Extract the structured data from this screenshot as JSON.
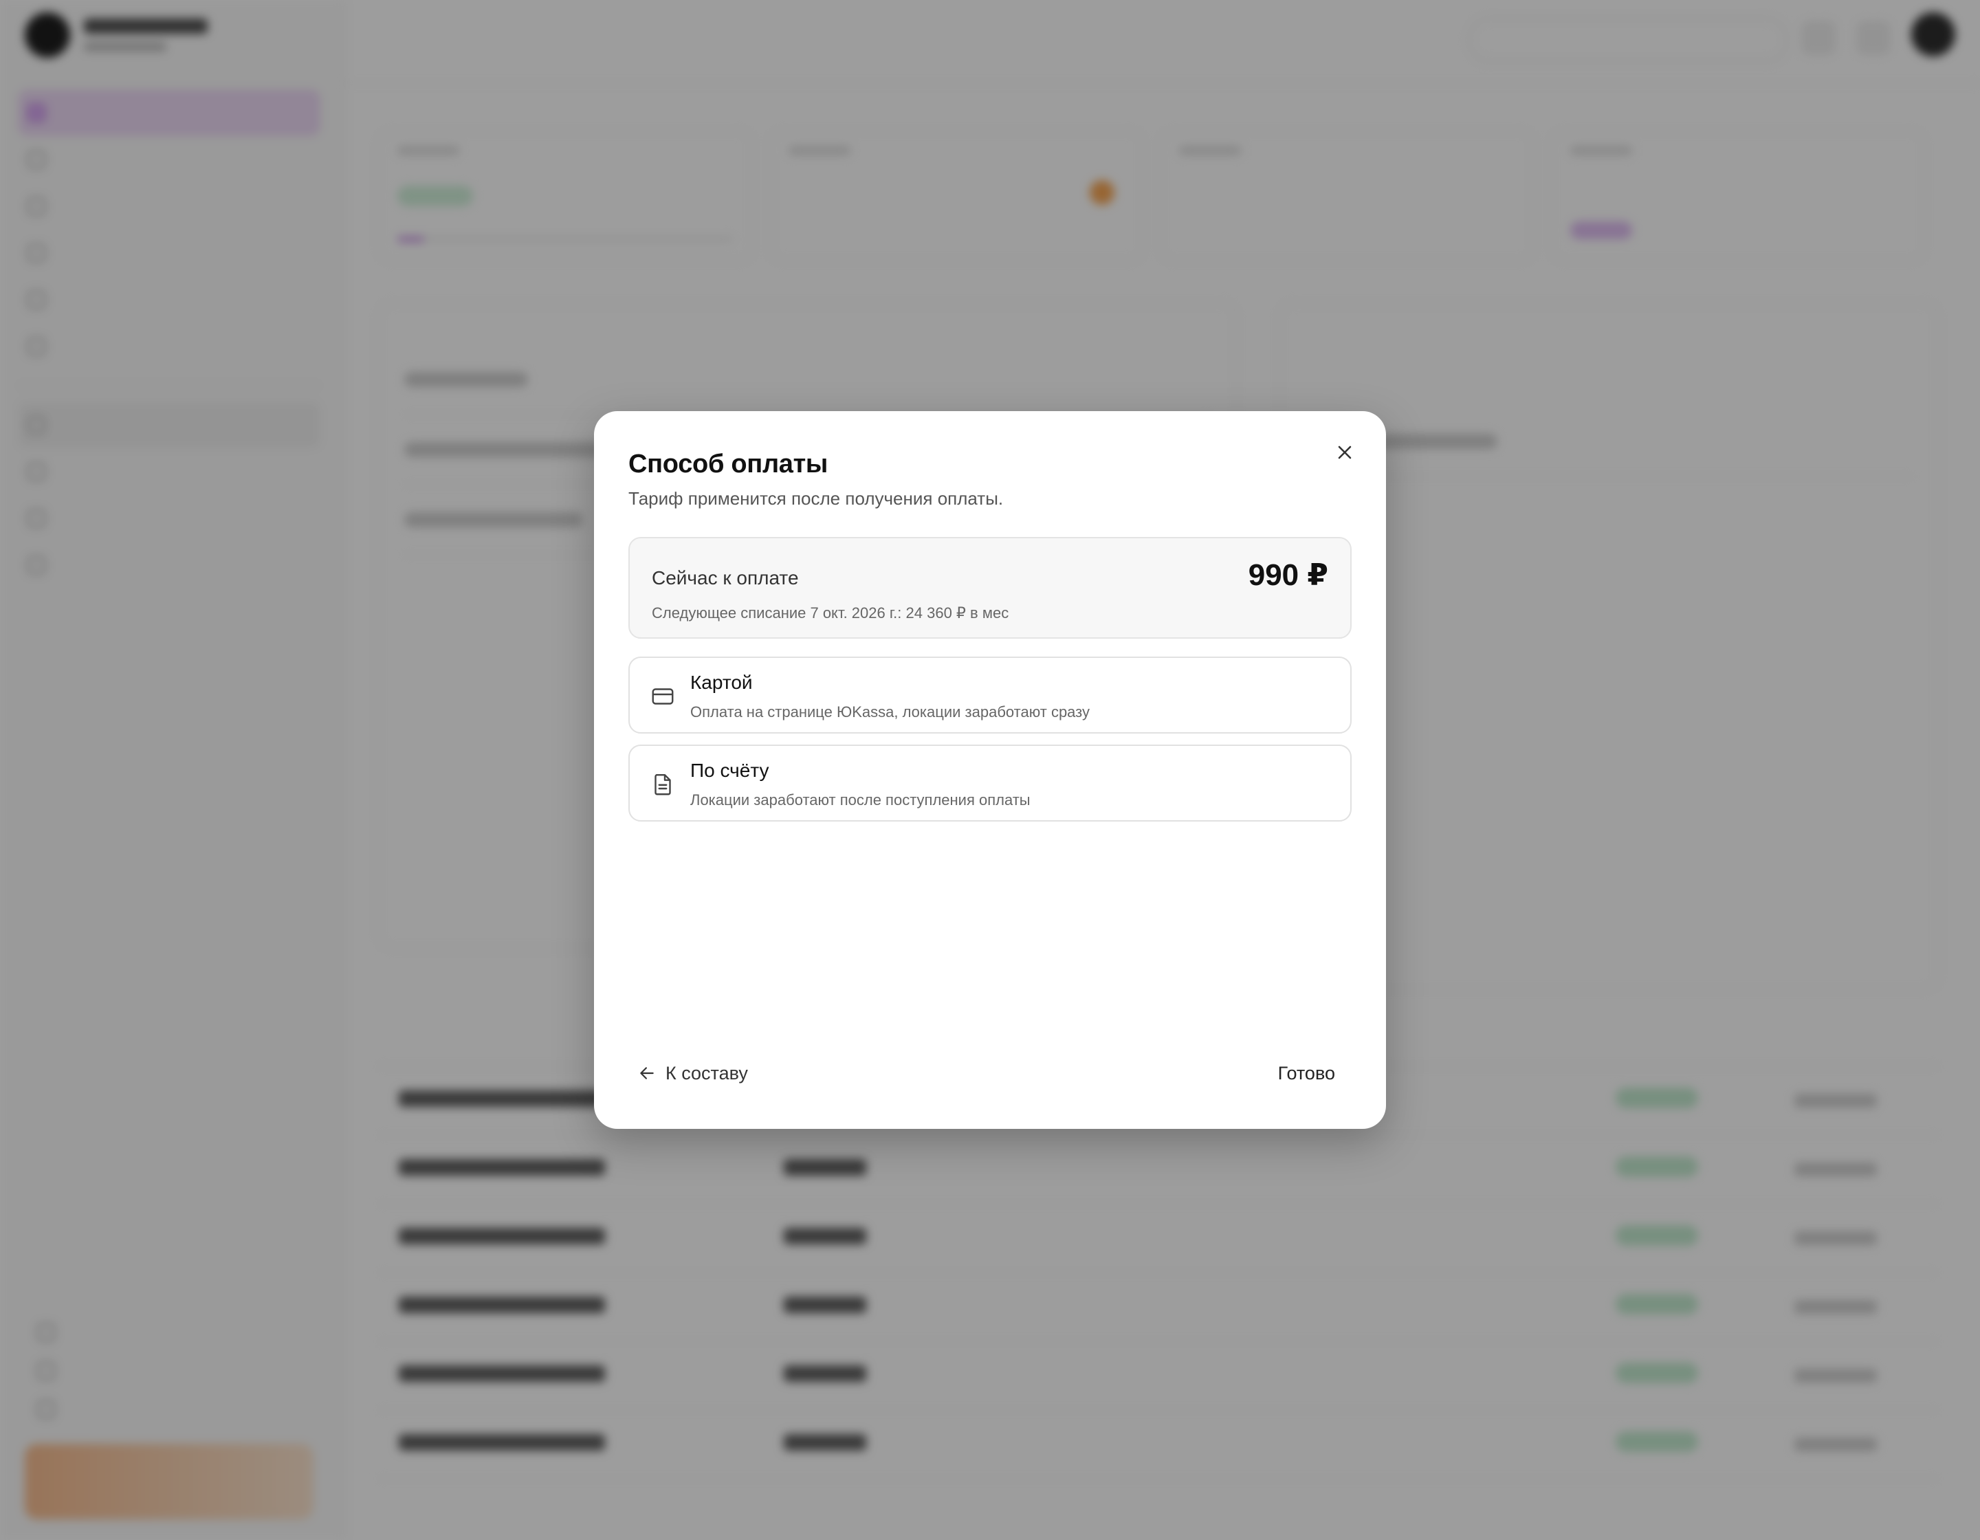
{
  "modal": {
    "title": "Способ оплаты",
    "subtitle": "Тариф применится после получения оплаты.",
    "close_icon": "close-icon",
    "due": {
      "label": "Сейчас к оплате",
      "amount": "990 ₽",
      "next_charge": "Следующее списание 7 окт. 2026 г.: 24 360 ₽ в мес"
    },
    "options": [
      {
        "icon": "credit-card-icon",
        "title": "Картой",
        "description": "Оплата на странице ЮKassa, локации заработают сразу"
      },
      {
        "icon": "document-icon",
        "title": "По счёту",
        "description": "Локации заработают после поступления оплаты"
      }
    ],
    "back": {
      "icon": "arrow-left-icon",
      "label": "К составу"
    },
    "done_label": "Готово"
  },
  "colors": {
    "overlay": "#161616",
    "modal_bg": "#ffffff",
    "accent_purple": "#c48ae0",
    "status_green": "#bfe8cc",
    "promo_orange": "#f7b98a"
  }
}
